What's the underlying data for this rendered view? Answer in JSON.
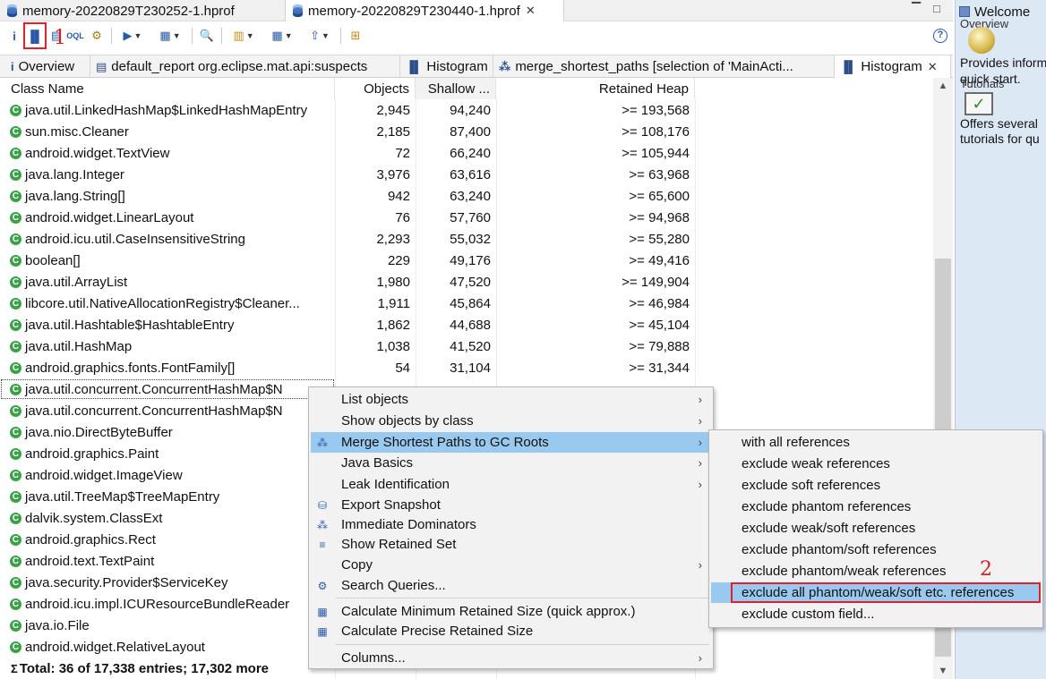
{
  "editor_tabs": [
    {
      "label": "memory-20220829T230252-1.hprof",
      "active": false
    },
    {
      "label": "memory-20220829T230440-1.hprof",
      "active": true
    }
  ],
  "editor_close": "✕",
  "window_controls": {
    "minimize": "▔",
    "maximize": "□"
  },
  "toolbar": {
    "info": "i",
    "histogram": "▐▌",
    "dominator": "▤",
    "oql": "OQL",
    "heap_dump_overview": "⚙",
    "reports": "▶",
    "queries": "▦",
    "search": "🔍",
    "group": "▥",
    "calculate": "▦",
    "export": "⇧",
    "compare": "⊞",
    "help": "?"
  },
  "annotations": {
    "marker_1": "1",
    "marker_2": "2"
  },
  "view_tabs": [
    {
      "icon": "i",
      "label": "Overview"
    },
    {
      "icon": "▤",
      "label": "default_report  org.eclipse.mat.api:suspects"
    },
    {
      "icon": "▐▌",
      "label": "Histogram"
    },
    {
      "icon": "⁂",
      "label": "merge_shortest_paths  [selection of 'MainActi..."
    },
    {
      "icon": "▐▌",
      "label": "Histogram",
      "active": true
    }
  ],
  "view_close": "✕",
  "table": {
    "headers": {
      "class_name": "Class Name",
      "objects": "Objects",
      "shallow": "Shallow ...",
      "retained": "Retained Heap"
    },
    "rows": [
      {
        "name": "java.util.LinkedHashMap$LinkedHashMapEntry",
        "objects": "2,945",
        "shallow": "94,240",
        "retained": ">= 193,568"
      },
      {
        "name": "sun.misc.Cleaner",
        "objects": "2,185",
        "shallow": "87,400",
        "retained": ">= 108,176"
      },
      {
        "name": "android.widget.TextView",
        "objects": "72",
        "shallow": "66,240",
        "retained": ">= 105,944"
      },
      {
        "name": "java.lang.Integer",
        "objects": "3,976",
        "shallow": "63,616",
        "retained": ">= 63,968"
      },
      {
        "name": "java.lang.String[]",
        "objects": "942",
        "shallow": "63,240",
        "retained": ">= 65,600"
      },
      {
        "name": "android.widget.LinearLayout",
        "objects": "76",
        "shallow": "57,760",
        "retained": ">= 94,968"
      },
      {
        "name": "android.icu.util.CaseInsensitiveString",
        "objects": "2,293",
        "shallow": "55,032",
        "retained": ">= 55,280"
      },
      {
        "name": "boolean[]",
        "objects": "229",
        "shallow": "49,176",
        "retained": ">= 49,416"
      },
      {
        "name": "java.util.ArrayList",
        "objects": "1,980",
        "shallow": "47,520",
        "retained": ">= 149,904"
      },
      {
        "name": "libcore.util.NativeAllocationRegistry$Cleaner...",
        "objects": "1,911",
        "shallow": "45,864",
        "retained": ">= 46,984"
      },
      {
        "name": "java.util.Hashtable$HashtableEntry",
        "objects": "1,862",
        "shallow": "44,688",
        "retained": ">= 45,104"
      },
      {
        "name": "java.util.HashMap",
        "objects": "1,038",
        "shallow": "41,520",
        "retained": ">= 79,888"
      },
      {
        "name": "android.graphics.fonts.FontFamily[]",
        "objects": "54",
        "shallow": "31,104",
        "retained": ">= 31,344"
      },
      {
        "name": "java.util.concurrent.ConcurrentHashMap$N",
        "objects": "",
        "shallow": "",
        "retained": "",
        "selected": true
      },
      {
        "name": "java.util.concurrent.ConcurrentHashMap$N",
        "objects": "",
        "shallow": "",
        "retained": ""
      },
      {
        "name": "java.nio.DirectByteBuffer",
        "objects": "",
        "shallow": "",
        "retained": ""
      },
      {
        "name": "android.graphics.Paint",
        "objects": "",
        "shallow": "",
        "retained": ""
      },
      {
        "name": "android.widget.ImageView",
        "objects": "",
        "shallow": "",
        "retained": ""
      },
      {
        "name": "java.util.TreeMap$TreeMapEntry",
        "objects": "",
        "shallow": "",
        "retained": ""
      },
      {
        "name": "dalvik.system.ClassExt",
        "objects": "",
        "shallow": "",
        "retained": ""
      },
      {
        "name": "android.graphics.Rect",
        "objects": "",
        "shallow": "",
        "retained": ""
      },
      {
        "name": "android.text.TextPaint",
        "objects": "",
        "shallow": "",
        "retained": ""
      },
      {
        "name": "java.security.Provider$ServiceKey",
        "objects": "",
        "shallow": "",
        "retained": ""
      },
      {
        "name": "android.icu.impl.ICUResourceBundleReader",
        "objects": "",
        "shallow": "",
        "retained": ""
      },
      {
        "name": "java.io.File",
        "objects": "",
        "shallow": "",
        "retained": ""
      },
      {
        "name": "android.widget.RelativeLayout",
        "objects": "",
        "shallow": "",
        "retained": ""
      }
    ],
    "total": "Total: 36 of 17,338 entries; 17,302 more",
    "total_sigma": "Σ"
  },
  "context_menu": [
    {
      "icon": "",
      "label": "List objects",
      "arrow": true
    },
    {
      "icon": "",
      "label": "Show objects by class",
      "arrow": true
    },
    {
      "icon": "⁂",
      "label": "Merge Shortest Paths to GC Roots",
      "arrow": true,
      "highlight": true
    },
    {
      "icon": "",
      "label": "Java Basics",
      "arrow": true
    },
    {
      "icon": "",
      "label": "Leak Identification",
      "arrow": true
    },
    {
      "icon": "⛁",
      "label": "Export Snapshot",
      "arrow": false
    },
    {
      "icon": "⁂",
      "label": "Immediate Dominators",
      "arrow": false
    },
    {
      "icon": "≡",
      "label": "Show Retained Set",
      "arrow": false
    },
    {
      "icon": "",
      "label": "Copy",
      "arrow": true
    },
    {
      "icon": "⚙",
      "label": "Search Queries...",
      "arrow": false
    },
    {
      "icon": "▦",
      "label": "Calculate Minimum Retained Size (quick approx.)",
      "arrow": false
    },
    {
      "icon": "▦",
      "label": "Calculate Precise Retained Size",
      "arrow": false
    },
    {
      "icon": "",
      "label": "Columns...",
      "arrow": true
    }
  ],
  "menu_arrow": "›",
  "submenu": [
    {
      "label": "with all references"
    },
    {
      "label": "exclude weak references"
    },
    {
      "label": "exclude soft references"
    },
    {
      "label": "exclude phantom references"
    },
    {
      "label": "exclude weak/soft references"
    },
    {
      "label": "exclude phantom/soft references"
    },
    {
      "label": "exclude phantom/weak references"
    },
    {
      "label": "exclude all phantom/weak/soft etc. references",
      "highlight": true
    },
    {
      "label": "exclude custom field..."
    }
  ],
  "right_pane": {
    "tab_label": "Welcome",
    "overview_title": "Overview",
    "overview_desc": "Provides inform",
    "overview_desc2": "quick start.",
    "tutorials_title": "Tutorials",
    "tutorials_desc": "Offers several",
    "tutorials_desc2": "tutorials for qu"
  },
  "colors": {
    "selection": "#99c9ef",
    "annotation_red": "#e0202a",
    "class_icon": "#3aa14a"
  }
}
